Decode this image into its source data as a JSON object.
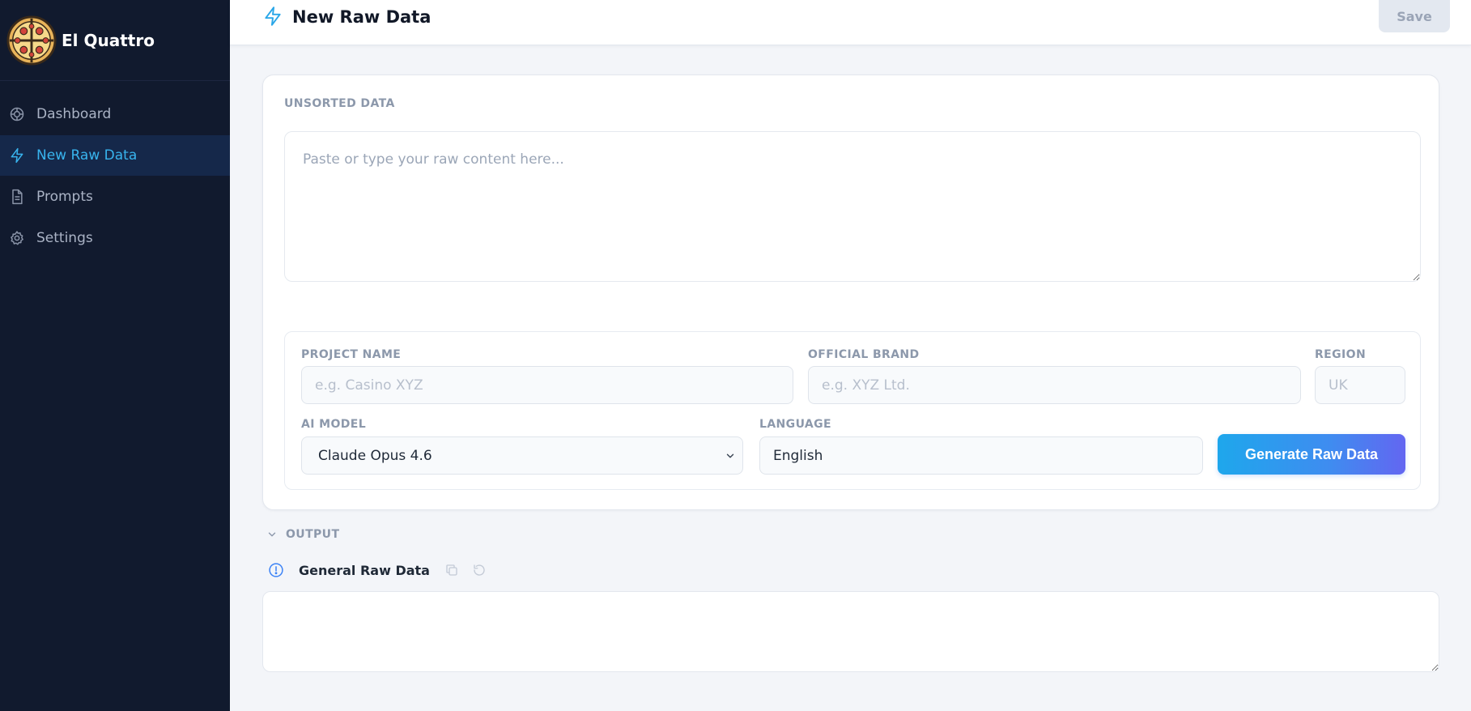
{
  "app": {
    "name": "El Quattro"
  },
  "sidebar": {
    "items": [
      {
        "label": "Dashboard",
        "icon": "dashboard-icon",
        "active": false
      },
      {
        "label": "New Raw Data",
        "icon": "lightning-icon",
        "active": true
      },
      {
        "label": "Prompts",
        "icon": "document-icon",
        "active": false
      },
      {
        "label": "Settings",
        "icon": "gear-icon",
        "active": false
      }
    ]
  },
  "header": {
    "title": "New Raw Data",
    "icon": "lightning-icon",
    "save_label": "Save"
  },
  "form": {
    "unsorted_label": "UNSORTED DATA",
    "unsorted_placeholder": "Paste or type your raw content here...",
    "project_name": {
      "label": "PROJECT NAME",
      "placeholder": "e.g. Casino XYZ",
      "value": ""
    },
    "official_brand": {
      "label": "OFFICIAL BRAND",
      "placeholder": "e.g. XYZ Ltd.",
      "value": ""
    },
    "region": {
      "label": "REGION",
      "placeholder": "UK",
      "value": ""
    },
    "ai_model": {
      "label": "AI MODEL",
      "value": "Claude Opus 4.6"
    },
    "language": {
      "label": "LANGUAGE",
      "value": "English"
    },
    "generate_label": "Generate Raw Data"
  },
  "output": {
    "section_label": "OUTPUT",
    "title": "General Raw Data",
    "value": ""
  },
  "colors": {
    "sidebar_bg": "#111a2e",
    "accent": "#38b4ee",
    "button_gradient_start": "#1ea7ec",
    "button_gradient_end": "#6366f1"
  }
}
